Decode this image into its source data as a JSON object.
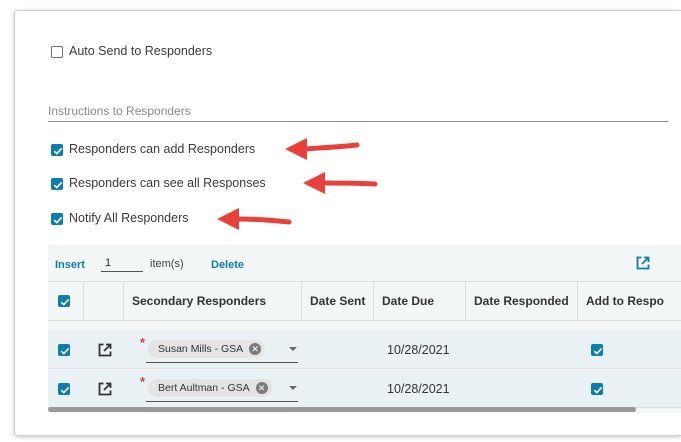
{
  "form": {
    "auto_send_label": "Auto Send to Responders",
    "auto_send_checked": false,
    "instructions_label": "Instructions to Responders",
    "options": [
      {
        "label": "Responders can add Responders",
        "checked": true
      },
      {
        "label": "Responders can see all Responses",
        "checked": true
      },
      {
        "label": "Notify All Responders",
        "checked": true
      }
    ]
  },
  "grid": {
    "toolbar": {
      "insert_label": "Insert",
      "insert_count": "1",
      "items_label": "item(s)",
      "delete_label": "Delete",
      "export_icon": "open-in-new-icon"
    },
    "columns": [
      "",
      "",
      "Secondary Responders",
      "Date Sent",
      "Date Due",
      "Date Responded",
      "Add to Respo"
    ],
    "rows": [
      {
        "selected": true,
        "responder": "Susan Mills - GSA",
        "date_sent": "",
        "date_due": "10/28/2021",
        "date_responded": "",
        "add_to_responders": true
      },
      {
        "selected": true,
        "responder": "Bert Aultman - GSA",
        "date_sent": "",
        "date_due": "10/28/2021",
        "date_responded": "",
        "add_to_responders": true
      }
    ]
  },
  "colors": {
    "accent": "#0f7dab",
    "arrow": "#e8413a",
    "required": "#e23c3c"
  }
}
